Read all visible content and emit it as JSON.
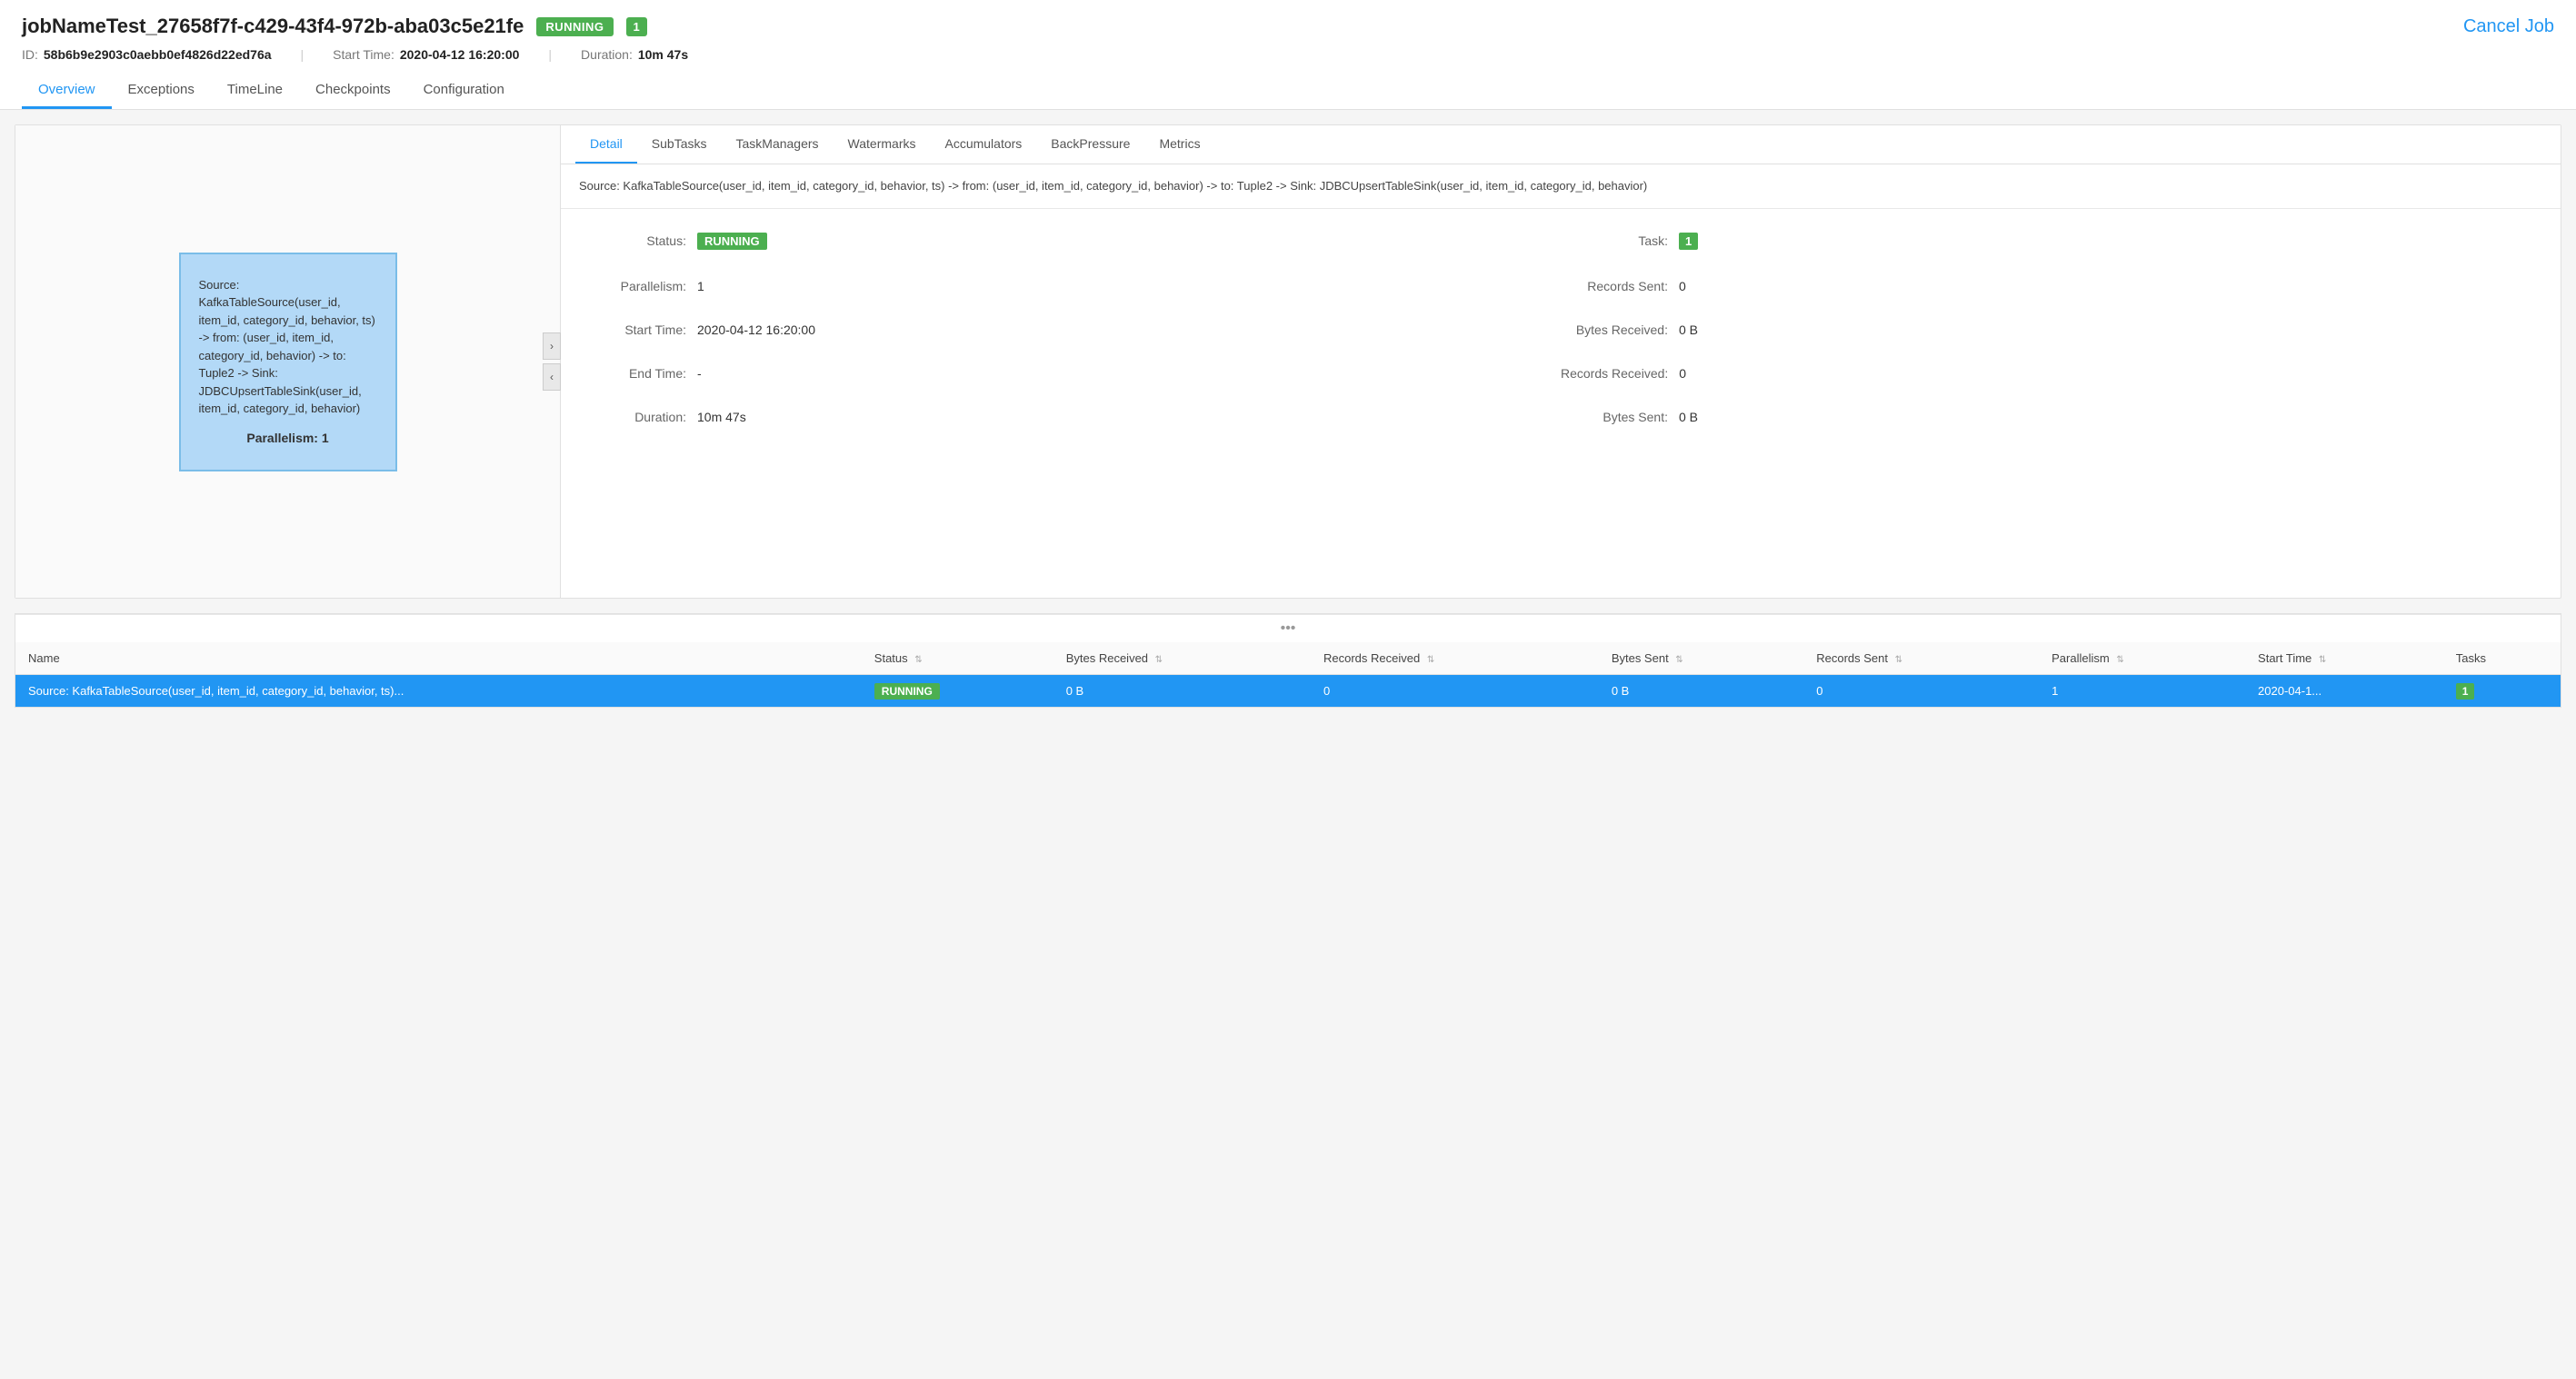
{
  "header": {
    "job_name": "jobNameTest_27658f7f-c429-43f4-972b-aba03c5e21fe",
    "status": "RUNNING",
    "task_count": "1",
    "id_label": "ID:",
    "id_value": "58b6b9e2903c0aebb0ef4826d22ed76a",
    "start_time_label": "Start Time:",
    "start_time_value": "2020-04-12 16:20:00",
    "duration_label": "Duration:",
    "duration_value": "10m 47s",
    "cancel_btn": "Cancel Job"
  },
  "tabs": [
    {
      "label": "Overview",
      "active": true
    },
    {
      "label": "Exceptions",
      "active": false
    },
    {
      "label": "TimeLine",
      "active": false
    },
    {
      "label": "Checkpoints",
      "active": false
    },
    {
      "label": "Configuration",
      "active": false
    }
  ],
  "graph": {
    "node_text": "Source: KafkaTableSource(user_id, item_id, category_id, behavior, ts) -> from: (user_id, item_id, category_id, behavior) -> to: Tuple2 -> Sink: JDBCUpsertTableSink(user_id, item_id, category_id, behavior)",
    "parallelism_label": "Parallelism: 1"
  },
  "detail": {
    "tabs": [
      "Detail",
      "SubTasks",
      "TaskManagers",
      "Watermarks",
      "Accumulators",
      "BackPressure",
      "Metrics"
    ],
    "active_tab": "Detail",
    "description": "Source: KafkaTableSource(user_id, item_id, category_id, behavior, ts) -> from: (user_id, item_id, category_id, behavior) -> to: Tuple2 -> Sink: JDBCUpsertTableSink(user_id, item_id, category_id, behavior)",
    "fields": [
      {
        "label": "Status:",
        "value": "RUNNING",
        "type": "badge"
      },
      {
        "label": "Task:",
        "value": "1",
        "type": "badge-num"
      },
      {
        "label": "Parallelism:",
        "value": "1",
        "type": "text"
      },
      {
        "label": "Records Sent:",
        "value": "0",
        "type": "text"
      },
      {
        "label": "Start Time:",
        "value": "2020-04-12 16:20:00",
        "type": "text"
      },
      {
        "label": "Bytes Received:",
        "value": "0 B",
        "type": "text"
      },
      {
        "label": "End Time:",
        "value": "-",
        "type": "text"
      },
      {
        "label": "Records Received:",
        "value": "0",
        "type": "text"
      },
      {
        "label": "Duration:",
        "value": "10m 47s",
        "type": "text"
      },
      {
        "label": "Bytes Sent:",
        "value": "0 B",
        "type": "text"
      }
    ]
  },
  "table": {
    "columns": [
      {
        "label": "Name",
        "sortable": false
      },
      {
        "label": "Status",
        "sortable": true
      },
      {
        "label": "Bytes Received",
        "sortable": true
      },
      {
        "label": "Records Received",
        "sortable": true
      },
      {
        "label": "Bytes Sent",
        "sortable": true
      },
      {
        "label": "Records Sent",
        "sortable": true
      },
      {
        "label": "Parallelism",
        "sortable": true
      },
      {
        "label": "Start Time",
        "sortable": true
      },
      {
        "label": "Tasks",
        "sortable": false
      }
    ],
    "rows": [
      {
        "name": "Source: KafkaTableSource(user_id, item_id, category_id, behavior, ts)...",
        "status": "RUNNING",
        "bytes_received": "0 B",
        "records_received": "0",
        "bytes_sent": "0 B",
        "records_sent": "0",
        "parallelism": "1",
        "start_time": "2020-04-1...",
        "tasks": "1",
        "selected": true
      }
    ]
  }
}
